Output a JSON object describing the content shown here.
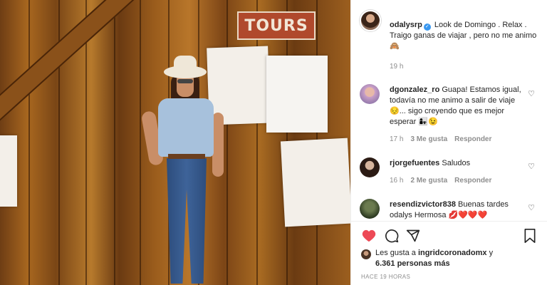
{
  "photo": {
    "sign_text": "TOURS"
  },
  "post": {
    "username": "odalysrp",
    "caption": "Look de Domingo . Relax . Traigo ganas de viajar , pero no me animo 🙈",
    "time": "19 h"
  },
  "comments": [
    {
      "username": "dgonzalez_ro",
      "text": "Guapa! Estamos igual, todavía no me animo a salir de viaje 😔... sigo creyendo que es mejor esperar 👩‍👧😉",
      "time": "17 h",
      "likes": "3 Me gusta",
      "reply": "Responder"
    },
    {
      "username": "rjorgefuentes",
      "text": "Saludos",
      "time": "16 h",
      "likes": "2 Me gusta",
      "reply": "Responder"
    },
    {
      "username": "resendizvictor838",
      "text": "Buenas tardes odalys Hermosa 💋❤️❤️❤️"
    }
  ],
  "likes": {
    "prefix": "Les gusta a",
    "user": "ingridcoronadomx",
    "suffix": "y",
    "count": "6.361 personas más"
  },
  "posted_ago": "HACE 19 HORAS",
  "icons": {
    "like": "heart-filled-icon",
    "comment": "comment-icon",
    "share": "share-icon",
    "save": "bookmark-icon",
    "comment_like": "heart-outline-icon",
    "verified": "verified-badge-icon"
  },
  "colors": {
    "like_red": "#ed4956",
    "verified_blue": "#3897f0",
    "secondary_text": "#8e8e8e"
  }
}
